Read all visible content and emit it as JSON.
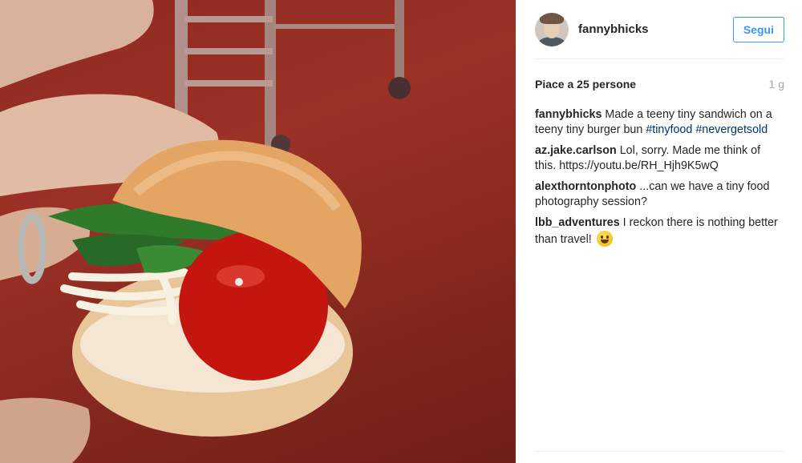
{
  "post": {
    "username": "fannybhicks",
    "follow_label": "Segui",
    "likes_prefix": "Piace a",
    "likes_count": "25",
    "likes_suffix": "persone",
    "time_ago": "1 g"
  },
  "photo": {
    "background_color": "#962c22"
  },
  "comments": [
    {
      "author": "fannybhicks",
      "text": "Made a teeny tiny sandwich on a teeny tiny burger bun",
      "tags": [
        "#tinyfood",
        "#nevergetsold"
      ]
    },
    {
      "author": "az.jake.carlson",
      "text": "Lol, sorry. Made me think of this. https://youtu.be/RH_Hjh9K5wQ"
    },
    {
      "author": "alexthorntonphoto",
      "text": "...can we have a tiny food photography session?"
    },
    {
      "author": "lbb_adventures",
      "text": "I reckon there is nothing better than travel!",
      "emoji": "smiley-emoji"
    }
  ],
  "colors": {
    "accent": "#3897f0",
    "hashtag": "#003569",
    "muted": "#a6a6a6",
    "text": "#262626"
  }
}
